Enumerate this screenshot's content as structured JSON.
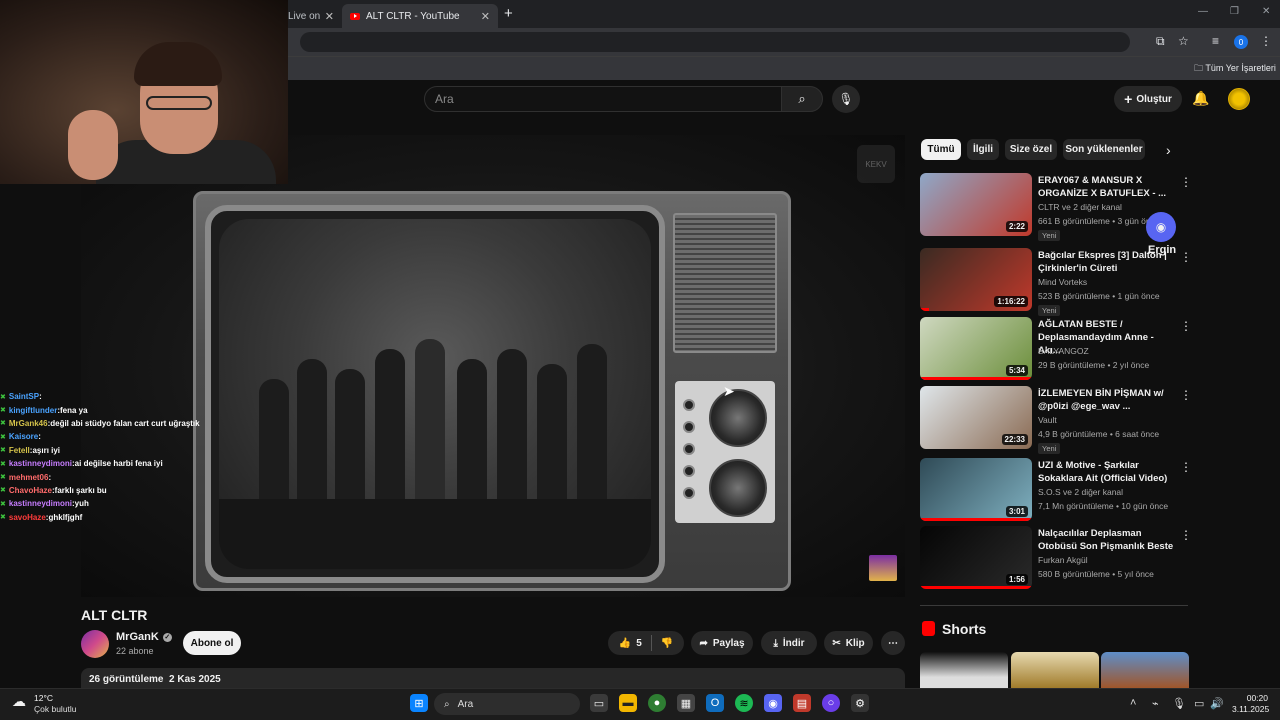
{
  "browser": {
    "tabs": [
      {
        "label": "Live on"
      },
      {
        "label": "ALT CLTR - YouTube"
      }
    ],
    "new_tab": "+",
    "profile_badge": "0",
    "bookmarks_all": "Tüm Yer İşaretleri"
  },
  "youtube": {
    "search_placeholder": "Ara",
    "create_label": "Oluştur",
    "player": {
      "watermark": "KEKV"
    },
    "video": {
      "title": "ALT CLTR",
      "channel_name": "MrGanK",
      "subscribers": "22 abone",
      "subscribe_label": "Abone ol",
      "likes": "5",
      "share_label": "Paylaş",
      "download_label": "İndir",
      "clip_label": "Klip",
      "views_date": "26 görüntüleme  2 Kas 2025"
    },
    "chips": [
      {
        "label": "Tümü",
        "active": true
      },
      {
        "label": "İlgili",
        "active": false
      },
      {
        "label": "Size özel",
        "active": false
      },
      {
        "label": "Son yüklenenler",
        "active": false
      }
    ],
    "recommendations": [
      {
        "title": "ERAY067 & MANSUR X ORGANİZE X BATUFLEX - ...",
        "channel": "CLTR ve 2 diğer kanal",
        "meta": "661 B görüntüleme • 3 gün önce",
        "badge": "Yeni",
        "duration": "2:22",
        "colors": [
          "#8fa8c8",
          "#c0392b"
        ],
        "progress": 0.0
      },
      {
        "title": "Bağcılar Ekspres [3] Dalton | Çirkinler'in Cüreti",
        "channel": "Mind Vorteks",
        "meta": "523 B görüntüleme • 1 gün önce",
        "badge": "Yeni",
        "duration": "1:16:22",
        "colors": [
          "#3a2a22",
          "#c0392b"
        ],
        "progress": 0.08
      },
      {
        "title": "AĞLATAN BESTE / Deplasmandaydım Anne  - Akı...",
        "channel": "BALYANGOZ",
        "meta": "29 B görüntüleme • 2 yıl önce",
        "badge": "",
        "duration": "5:34",
        "colors": [
          "#cfd8c0",
          "#6b8e3a"
        ],
        "progress": 1.0
      },
      {
        "title": "İZLEMEYEN BİN PİŞMAN w/ @p0izi @ege_wav ...",
        "channel": "Vault",
        "meta": "4,9 B görüntüleme • 6 saat önce",
        "badge": "Yeni",
        "duration": "22:33",
        "colors": [
          "#dfe6ea",
          "#8a6a52"
        ],
        "progress": 0.0
      },
      {
        "title": "UZI & Motive - Şarkılar Sokaklara Ait (Official Video)",
        "channel": "S.O.S ve 2 diğer kanal",
        "meta": "7,1 Mn görüntüleme • 10 gün önce",
        "badge": "",
        "duration": "3:01",
        "colors": [
          "#2f4a56",
          "#7fb0c0"
        ],
        "progress": 1.0
      },
      {
        "title": "Nalçacılılar Deplasman Otobüsü Son Pişmanlık Beste",
        "channel": "Furkan Akgül",
        "meta": "580 B görüntüleme • 5 yıl önce",
        "badge": "",
        "duration": "1:56",
        "colors": [
          "#050505",
          "#2a2a2a"
        ],
        "progress": 1.0
      }
    ],
    "shorts_title": "Shorts",
    "discord_overlay_label": "Ergin"
  },
  "chat": [
    {
      "user": "SaintSP",
      "color": "#4aa3ff",
      "msg": ""
    },
    {
      "user": "kingiftlunder",
      "color": "#4aa3ff",
      "msg": "fena ya"
    },
    {
      "user": "MrGank46",
      "color": "#d4c24a",
      "msg": "değil abi stüdyo falan cart curt uğraştık"
    },
    {
      "user": "Kaisore",
      "color": "#4aa3ff",
      "msg": ""
    },
    {
      "user": "Fetell",
      "color": "#d4c24a",
      "msg": "aşırı iyi"
    },
    {
      "user": "kastinneydimoni",
      "color": "#c77dff",
      "msg": "ai değilse harbi fena iyi"
    },
    {
      "user": "mehmet06",
      "color": "#ff6b6b",
      "msg": ""
    },
    {
      "user": "ChavoHaze",
      "color": "#ff6b6b",
      "msg": "farklı şarkı bu"
    },
    {
      "user": "kastinneydimoni",
      "color": "#c77dff",
      "msg": "yuh"
    },
    {
      "user": "savoHaze",
      "color": "#ff3b3b",
      "msg": "ghklfjghf"
    }
  ],
  "taskbar": {
    "temperature": "12°C",
    "weather": "Çok bulutlu",
    "search_placeholder": "Ara",
    "time": "00:20",
    "date": "3.11.2025"
  }
}
